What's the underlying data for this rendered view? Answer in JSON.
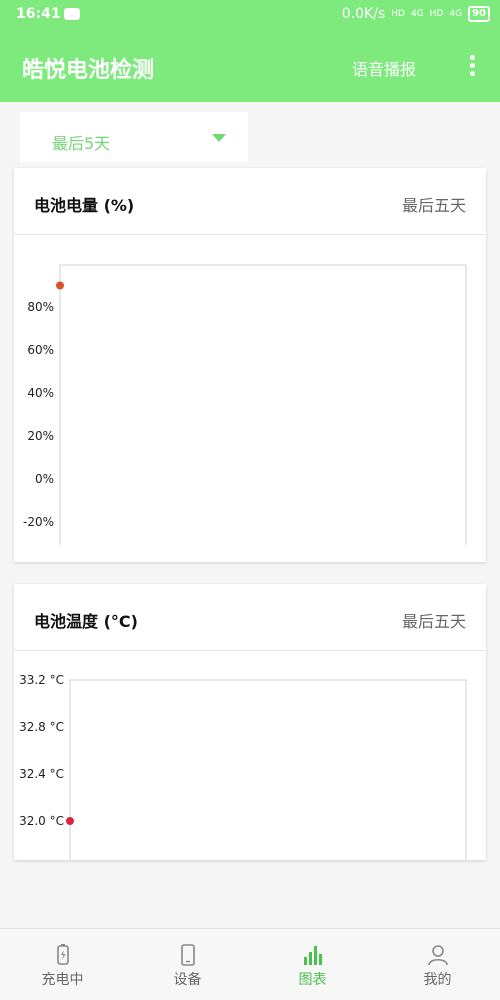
{
  "status_bar": {
    "time": "16:41",
    "network_speed": "0.0K/s",
    "signal_1": "4G",
    "signal_2": "4G",
    "hd_1": "HD",
    "hd_2": "HD",
    "battery": "90"
  },
  "app_bar": {
    "title": "皓悦电池检测",
    "voice_label": "语音播报",
    "menu_icon": "more-vertical-icon"
  },
  "range_select": {
    "selected": "最后5天"
  },
  "cards": {
    "battery": {
      "title": "电池电量 (%)",
      "range": "最后五天"
    },
    "temperature": {
      "title": "电池温度 (°C)",
      "range": "最后五天"
    }
  },
  "chart_data": [
    {
      "type": "scatter",
      "title": "电池电量 (%)",
      "y_tick_labels": [
        "80%",
        "60%",
        "40%",
        "20%",
        "0%",
        "-20%"
      ],
      "y_ticks": [
        80,
        60,
        40,
        20,
        0,
        -20
      ],
      "ylim": [
        -25,
        100
      ],
      "series": [
        {
          "points": [
            {
              "y": 90
            }
          ],
          "color": "#d9532b"
        }
      ]
    },
    {
      "type": "scatter",
      "title": "电池温度 (°C)",
      "y_tick_labels": [
        "33.2 °C",
        "32.8 °C",
        "32.4 °C",
        "32.0 °C"
      ],
      "y_ticks": [
        33.2,
        32.8,
        32.4,
        32.0
      ],
      "series": [
        {
          "points": [
            {
              "y": 32.0
            }
          ],
          "color": "#d6283b"
        }
      ]
    }
  ],
  "bottom_nav": [
    {
      "label": "充电中",
      "icon": "battery-charging-icon",
      "active": false
    },
    {
      "label": "设备",
      "icon": "phone-icon",
      "active": false
    },
    {
      "label": "图表",
      "icon": "bar-chart-icon",
      "active": true
    },
    {
      "label": "我的",
      "icon": "user-icon",
      "active": false
    }
  ],
  "colors": {
    "primary": "#7eea7e",
    "accent": "#4cc04c",
    "battery_point": "#d9532b",
    "temp_point": "#d6283b"
  }
}
